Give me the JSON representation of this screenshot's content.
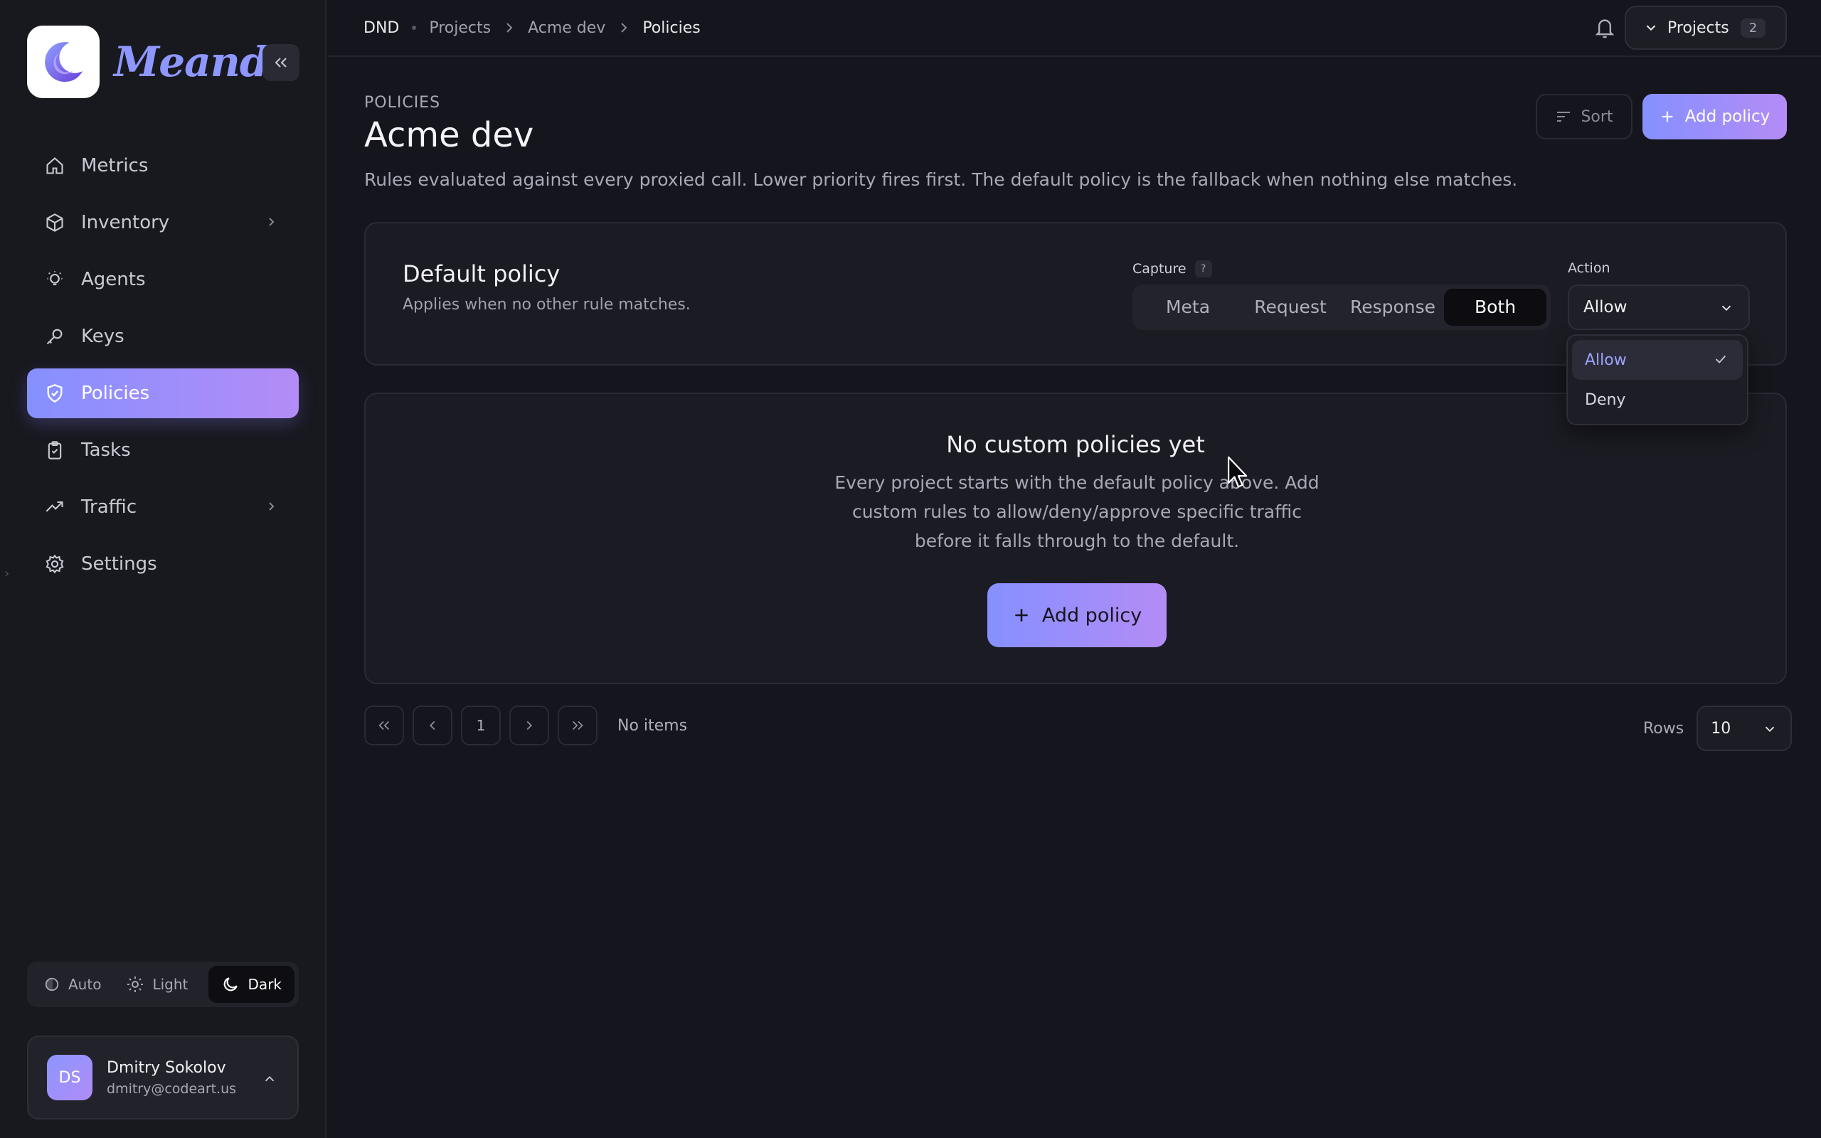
{
  "brand": {
    "name": "Meandr",
    "logo_icon": "crescent-moon-icon"
  },
  "sidebar": {
    "items": [
      {
        "label": "Metrics",
        "icon": "home-icon",
        "has_submenu": false,
        "active": false
      },
      {
        "label": "Inventory",
        "icon": "box-icon",
        "has_submenu": true,
        "active": false
      },
      {
        "label": "Agents",
        "icon": "bulb-icon",
        "has_submenu": false,
        "active": false
      },
      {
        "label": "Keys",
        "icon": "key-icon",
        "has_submenu": false,
        "active": false
      },
      {
        "label": "Policies",
        "icon": "shield-check-icon",
        "has_submenu": false,
        "active": true
      },
      {
        "label": "Tasks",
        "icon": "clipboard-check-icon",
        "has_submenu": false,
        "active": false
      },
      {
        "label": "Traffic",
        "icon": "trend-icon",
        "has_submenu": true,
        "active": false
      },
      {
        "label": "Settings",
        "icon": "gear-icon",
        "has_submenu": false,
        "active": false
      }
    ],
    "theme": {
      "auto": "Auto",
      "light": "Light",
      "dark": "Dark",
      "selected": "Dark"
    },
    "user": {
      "initials": "DS",
      "name": "Dmitry Sokolov",
      "email": "dmitry@codeart.us"
    }
  },
  "topbar": {
    "breadcrumb": [
      "DND",
      "Projects",
      "Acme dev",
      "Policies"
    ],
    "projects_button": {
      "label": "Projects",
      "count": "2"
    }
  },
  "page": {
    "eyebrow": "POLICIES",
    "title": "Acme dev",
    "description": "Rules evaluated against every proxied call. Lower priority fires first. The default policy is the fallback when nothing else matches.",
    "sort_label": "Sort",
    "add_policy_label": "Add policy"
  },
  "default_policy": {
    "title": "Default policy",
    "subtitle": "Applies when no other rule matches.",
    "capture_label": "Capture",
    "capture_help": "?",
    "capture_options": [
      "Meta",
      "Request",
      "Response",
      "Both"
    ],
    "capture_selected": "Both",
    "action_label": "Action",
    "action_value": "Allow",
    "action_options": [
      "Allow",
      "Deny"
    ]
  },
  "empty_state": {
    "title": "No custom policies yet",
    "text": "Every project starts with the default policy above. Add custom rules to allow/deny/approve specific traffic before it falls through to the default.",
    "button_label": "Add policy"
  },
  "pagination": {
    "page": "1",
    "status": "No items",
    "rows_label": "Rows",
    "rows_value": "10"
  },
  "colors": {
    "background": "#15151d",
    "accent_start": "#8590ff",
    "accent_end": "#b48cf6",
    "selected_text": "#9aa2ff"
  }
}
